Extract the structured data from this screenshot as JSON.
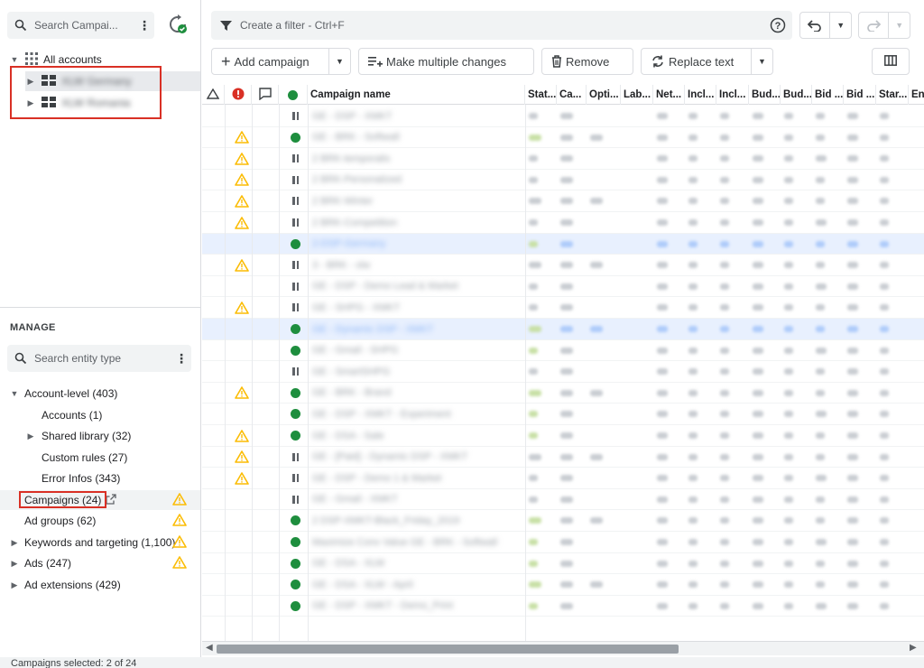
{
  "colors": {
    "accent": "#1a73e8",
    "enabled": "#1e8e3e",
    "warning": "#fbbc04",
    "error": "#d93025",
    "selection": "#e8f0fe"
  },
  "left": {
    "search_placeholder": "Search Campai...",
    "all_accounts": "All accounts",
    "accounts": [
      {
        "label": "XLW Germany"
      },
      {
        "label": "XLW Romania"
      }
    ],
    "manage_title": "MANAGE",
    "entity_search_placeholder": "Search entity type",
    "tree": [
      {
        "label": "Account-level (403)",
        "level": 0,
        "expand": "down",
        "warn": false
      },
      {
        "label": "Accounts (1)",
        "level": 1,
        "expand": "",
        "warn": false
      },
      {
        "label": "Shared library (32)",
        "level": 1,
        "expand": "right",
        "warn": false
      },
      {
        "label": "Custom rules (27)",
        "level": 1,
        "expand": "",
        "warn": false
      },
      {
        "label": "Error Infos (343)",
        "level": 1,
        "expand": "",
        "warn": false
      },
      {
        "label": "Campaigns (24)",
        "level": 0,
        "expand": "",
        "warn": true,
        "selected": true
      },
      {
        "label": "Ad groups (62)",
        "level": 0,
        "expand": "",
        "warn": true
      },
      {
        "label": "Keywords and targeting (1,100)",
        "level": 0,
        "expand": "right",
        "warn": true
      },
      {
        "label": "Ads (247)",
        "level": 0,
        "expand": "right",
        "warn": true
      },
      {
        "label": "Ad extensions (429)",
        "level": 0,
        "expand": "right",
        "warn": false
      }
    ]
  },
  "toolbar": {
    "filter_placeholder": "Create a filter - Ctrl+F",
    "add_campaign": "Add campaign",
    "make_multiple_changes": "Make multiple changes",
    "remove": "Remove",
    "replace_text": "Replace text"
  },
  "grid": {
    "columns": [
      "Campaign name",
      "Stat...",
      "Ca...",
      "Opti...",
      "Lab...",
      "Net...",
      "Incl...",
      "Incl...",
      "Bud...",
      "Bud...",
      "Bid ...",
      "Bid ...",
      "Star...",
      "En"
    ],
    "rows": [
      {
        "warn": false,
        "status": "paused",
        "name": "GE - DSP - XMKT"
      },
      {
        "warn": true,
        "status": "enabled",
        "name": "GE - BRK - Softwall"
      },
      {
        "warn": true,
        "status": "paused",
        "name": "2 BRK-temporalis"
      },
      {
        "warn": true,
        "status": "paused",
        "name": "2 BRK-Personalized"
      },
      {
        "warn": true,
        "status": "paused",
        "name": "2 BRK-Winter"
      },
      {
        "warn": true,
        "status": "paused",
        "name": "2 BRK-Competition"
      },
      {
        "warn": false,
        "status": "enabled",
        "name": "2-DSP-Germany",
        "selected": true
      },
      {
        "warn": true,
        "status": "paused",
        "name": "3 - BRK - xlw"
      },
      {
        "warn": false,
        "status": "paused",
        "name": "GE - DSP - Demo Lead & Market"
      },
      {
        "warn": true,
        "status": "paused",
        "name": "GE - SHPG - XMKT"
      },
      {
        "warn": false,
        "status": "enabled",
        "name": "GE - Dynamic DSP - XMKT",
        "selected": true
      },
      {
        "warn": false,
        "status": "enabled",
        "name": "GE - Gmail - SHPG"
      },
      {
        "warn": false,
        "status": "paused",
        "name": "GE - SmartSHPG"
      },
      {
        "warn": true,
        "status": "enabled",
        "name": "GE - BRK - Brand"
      },
      {
        "warn": false,
        "status": "enabled",
        "name": "GE - DSP - XMKT - Experiment"
      },
      {
        "warn": true,
        "status": "enabled",
        "name": "GE - DSA - Sale"
      },
      {
        "warn": true,
        "status": "paused",
        "name": "GE - [Paid] - Dynamic DSP - XMKT"
      },
      {
        "warn": true,
        "status": "paused",
        "name": "GE - DSP - Demo 1 & Market"
      },
      {
        "warn": false,
        "status": "paused",
        "name": "GE - Gmail - XMKT"
      },
      {
        "warn": false,
        "status": "enabled",
        "name": "2 DSP-XMKT-Black_Friday_2019"
      },
      {
        "warn": false,
        "status": "enabled",
        "name": "Maximize Conv Value GE - BRK - Softwall"
      },
      {
        "warn": false,
        "status": "enabled",
        "name": "GE - DSA - XLW"
      },
      {
        "warn": false,
        "status": "enabled",
        "name": "GE - DSA - XLW - April"
      },
      {
        "warn": false,
        "status": "enabled",
        "name": "GE - DSP - XMKT - Demo_Print"
      }
    ]
  },
  "status_bar": {
    "text": "Campaigns selected: 2 of 24"
  }
}
